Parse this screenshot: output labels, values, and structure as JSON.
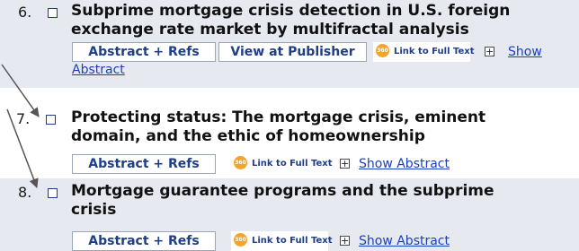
{
  "results": [
    {
      "number": "6.",
      "title_line1": "Subprime mortgage crisis detection in U.S. foreign",
      "title_line2": "exchange rate market by multifractal analysis",
      "abstract_refs": "Abstract + Refs",
      "view_publisher": "View at Publisher",
      "link_full_text": "Link to Full Text",
      "show_abstract_part1": "Show",
      "show_abstract_part2": "Abstract",
      "badge": "360"
    },
    {
      "number": "7.",
      "title_line1": "Protecting status: The mortgage crisis, eminent",
      "title_line2": "domain, and the ethic of homeownership",
      "abstract_refs": "Abstract + Refs",
      "link_full_text": "Link to Full Text",
      "show_abstract": "Show Abstract",
      "badge": "360"
    },
    {
      "number": "8.",
      "title_line1": "Mortgage guarantee programs and the subprime",
      "title_line2": "crisis",
      "abstract_refs": "Abstract + Refs",
      "link_full_text": "Link to Full Text",
      "show_abstract": "Show Abstract",
      "badge": "360"
    }
  ],
  "colors": {
    "row_highlight": "#e6eaf0",
    "button_text": "#1f3e88",
    "link": "#1a3fbd",
    "badge_orange": "#f3a52a",
    "arrow": "#555555"
  }
}
